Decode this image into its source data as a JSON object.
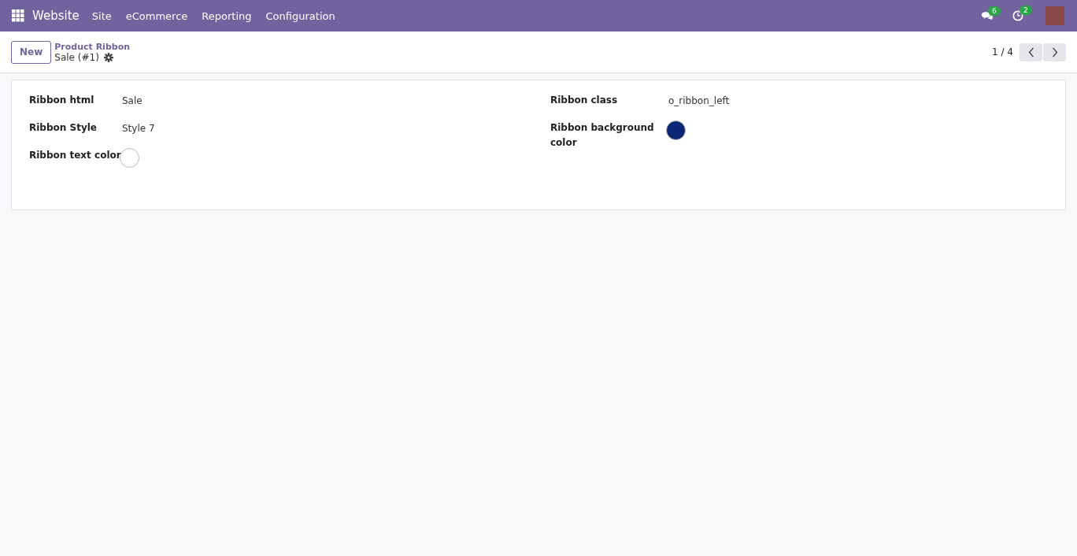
{
  "navbar": {
    "app": "Website",
    "menu": [
      "Site",
      "eCommerce",
      "Reporting",
      "Configuration"
    ],
    "messages_count": "6",
    "activities_count": "2"
  },
  "control_panel": {
    "new_button": "New",
    "breadcrumb": "Product Ribbon",
    "record": "Sale (#1)",
    "pager": "1 / 4"
  },
  "form": {
    "columns": [
      [
        {
          "label": "Ribbon html",
          "kind": "text",
          "value": "Sale"
        },
        {
          "label": "Ribbon Style",
          "kind": "text",
          "value": "Style 7"
        },
        {
          "label": "Ribbon text color",
          "kind": "color",
          "color": "#ffffff"
        }
      ],
      [
        {
          "label": "Ribbon class",
          "kind": "text",
          "value": "o_ribbon_left"
        },
        {
          "label": "Ribbon background color",
          "kind": "color",
          "color": "#0a2775"
        }
      ]
    ]
  }
}
